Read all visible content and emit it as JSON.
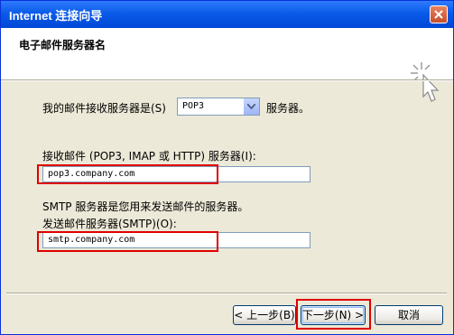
{
  "window": {
    "title": "Internet 连接向导"
  },
  "header": {
    "title": "电子邮件服务器名"
  },
  "incoming_type": {
    "label_before": "我的邮件接收服务器是(S)",
    "selected": "POP3",
    "label_after": "服务器。"
  },
  "incoming_server": {
    "label": "接收邮件 (POP3, IMAP 或 HTTP) 服务器(I):",
    "value": "pop3.company.com"
  },
  "smtp_note": "SMTP 服务器是您用来发送邮件的服务器。",
  "outgoing_server": {
    "label": "发送邮件服务器(SMTP)(O):",
    "value": "smtp.company.com"
  },
  "buttons": {
    "back": "< 上一步(B)",
    "next": "下一步(N) >",
    "cancel": "取消"
  },
  "colors": {
    "titlebar": "#0A5BE8",
    "highlight": "#E00000",
    "dialog_bg": "#ECE9D8"
  },
  "icons": {
    "close": "close-icon",
    "wizard": "wizard-cursor-icon",
    "dropdown": "chevron-down-icon"
  }
}
